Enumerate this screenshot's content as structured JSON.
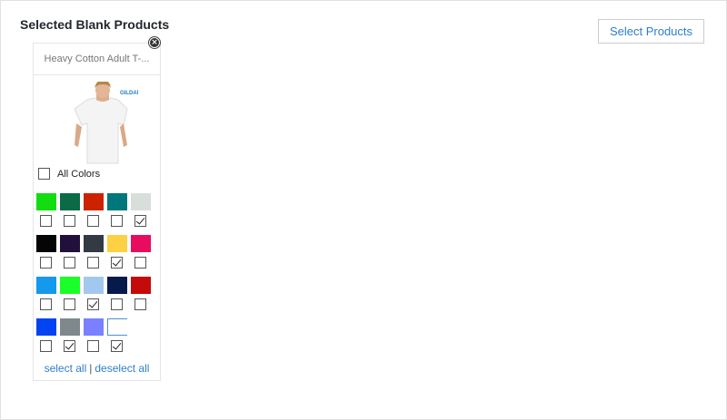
{
  "header": {
    "title": "Selected Blank Products",
    "select_button": "Select Products"
  },
  "product": {
    "name": "Heavy Cotton Adult T-...",
    "brand_logo": "GILDAN",
    "all_colors_label": "All Colors",
    "all_colors_checked": false,
    "colors": [
      {
        "hex": "#11dd11",
        "checked": false
      },
      {
        "hex": "#0a6b46",
        "checked": false
      },
      {
        "hex": "#cc2200",
        "checked": false
      },
      {
        "hex": "#00777a",
        "checked": false
      },
      {
        "hex": "#d8dfdb",
        "checked": true
      },
      {
        "hex": "#050505",
        "checked": false
      },
      {
        "hex": "#21113a",
        "checked": false
      },
      {
        "hex": "#333a44",
        "checked": false
      },
      {
        "hex": "#fed044",
        "checked": true
      },
      {
        "hex": "#e80c5e",
        "checked": false
      },
      {
        "hex": "#1599ec",
        "checked": false
      },
      {
        "hex": "#1aff2a",
        "checked": false
      },
      {
        "hex": "#a3c8ef",
        "checked": true
      },
      {
        "hex": "#061a4b",
        "checked": false
      },
      {
        "hex": "#c50a0c",
        "checked": false
      },
      {
        "hex": "#0243f2",
        "checked": false
      },
      {
        "hex": "#7f888c",
        "checked": true
      },
      {
        "hex": "#7a80ff",
        "checked": false
      },
      {
        "hex": "#ffffff",
        "checked": true
      }
    ],
    "select_all": "select all",
    "separator": "|",
    "deselect_all": "deselect all"
  }
}
